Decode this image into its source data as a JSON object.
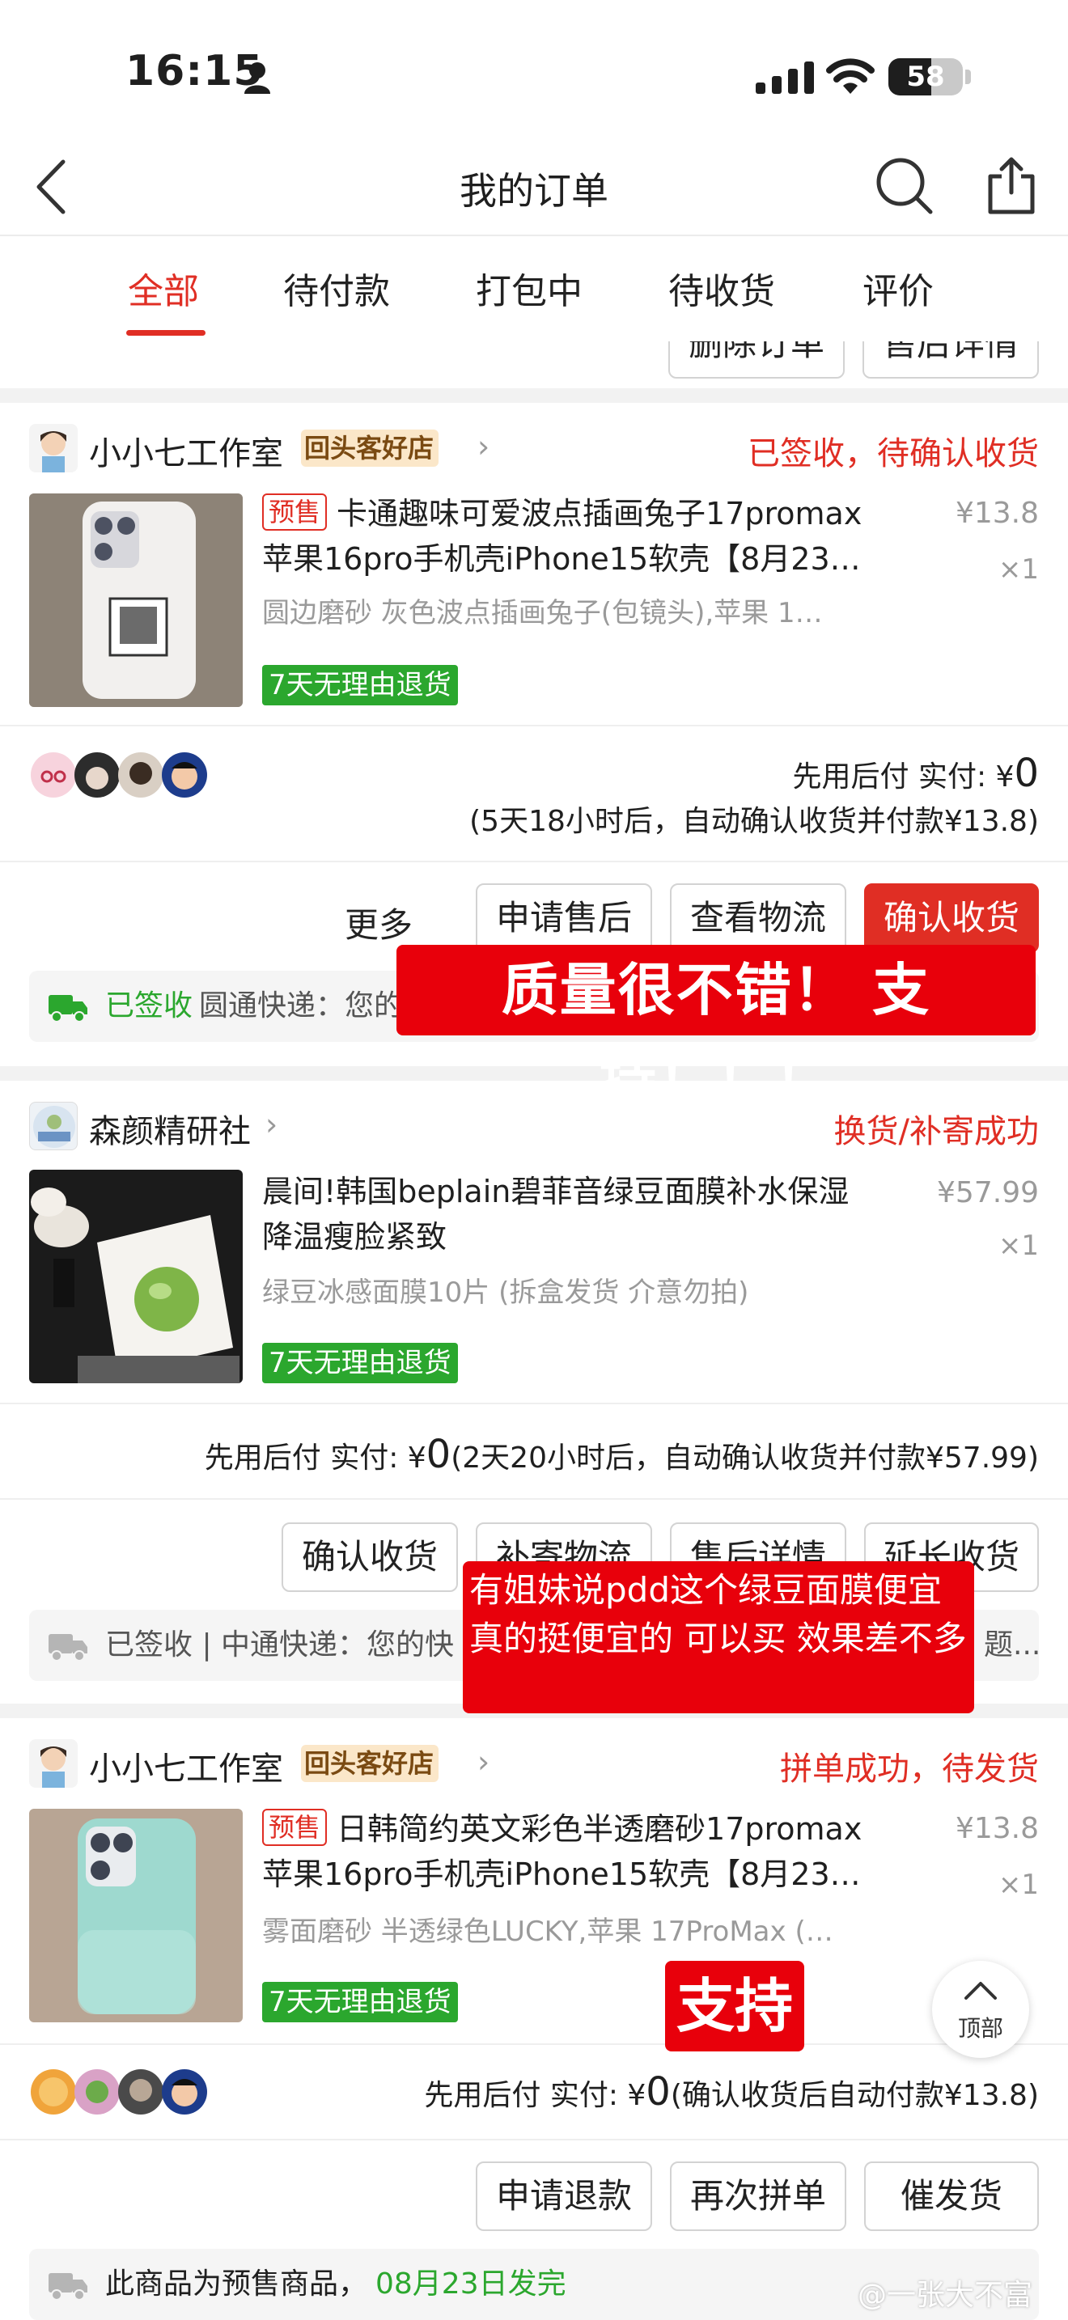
{
  "status_bar": {
    "time": "16:15",
    "battery": "58",
    "battery_level": 0.58
  },
  "nav": {
    "title": "我的订单"
  },
  "tabs": [
    {
      "label": "全部",
      "active": true
    },
    {
      "label": "待付款"
    },
    {
      "label": "打包中"
    },
    {
      "label": "待收货"
    },
    {
      "label": "评价"
    }
  ],
  "top_partial": {
    "buttons": [
      "删除订单",
      "售后详情"
    ]
  },
  "orders": [
    {
      "shop": "小小七工作室",
      "shop_tag": "回头客好店",
      "status": "已签收，待确认收货",
      "presale": "预售",
      "title_line1": "卡通趣味可爱波点插画兔子17promax",
      "title_line2": "苹果16pro手机壳iPhone15软壳【8月23…",
      "spec": "圆边磨砂  灰色波点插画兔子(包镜头),苹果 1…",
      "price": "¥13.8",
      "qty": "×1",
      "return_badge": "7天无理由退货",
      "pay_label": "先用后付 实付: ¥",
      "pay_amount": "0",
      "pay_note": "(5天18小时后，自动确认收货并付款¥13.8)",
      "more": "更多",
      "buttons": [
        "申请售后",
        "查看物流",
        "确认收货"
      ],
      "tracking_status": "已签收",
      "tracking_text": "圆通快递：您的"
    },
    {
      "shop": "森颜精研社",
      "status": "换货/补寄成功",
      "title_line1": "晨间!韩国beplain碧菲音绿豆面膜补水保湿",
      "title_line2": "降温瘦脸紧致",
      "spec": "绿豆冰感面膜10片 (拆盒发货 介意勿拍)",
      "price": "¥57.99",
      "qty": "×1",
      "return_badge": "7天无理由退货",
      "pay_label": "先用后付 实付: ¥",
      "pay_amount": "0",
      "pay_note": "(2天20小时后，自动确认收货并付款¥57.99)",
      "buttons": [
        "确认收货",
        "补寄物流",
        "售后详情",
        "延长收货"
      ],
      "tracking_text": "已签收 | 中通快递：您的快",
      "tracking_tail": "题..."
    },
    {
      "shop": "小小七工作室",
      "shop_tag": "回头客好店",
      "status": "拼单成功，待发货",
      "presale": "预售",
      "title_line1": "日韩简约英文彩色半透磨砂17promax",
      "title_line2": "苹果16pro手机壳iPhone15软壳【8月23…",
      "spec": "雾面磨砂  半透绿色LUCKY,苹果 17ProMax (…",
      "price": "¥13.8",
      "qty": "×1",
      "return_badge": "7天无理由退货",
      "pay_label": "先用后付 实付: ¥",
      "pay_amount": "0",
      "pay_note": "(确认收货后自动付款¥13.8)",
      "buttons": [
        "申请退款",
        "再次拼单",
        "催发货"
      ],
      "presale_note": "此商品为预售商品，",
      "ship_date": "08月23日发完"
    }
  ],
  "overlays": {
    "caption1": "质量很不错！ 支持！！！",
    "caption2": "有姐妹说pdd这个绿豆面膜便宜 真的挺便宜的 可以买 效果差不多",
    "caption3": "支持"
  },
  "back_to_top": "顶部",
  "watermark": "@一张大不富",
  "colors": {
    "accent": "#e02e24",
    "green": "#2ba72e",
    "overlay_red": "#e8000b"
  }
}
